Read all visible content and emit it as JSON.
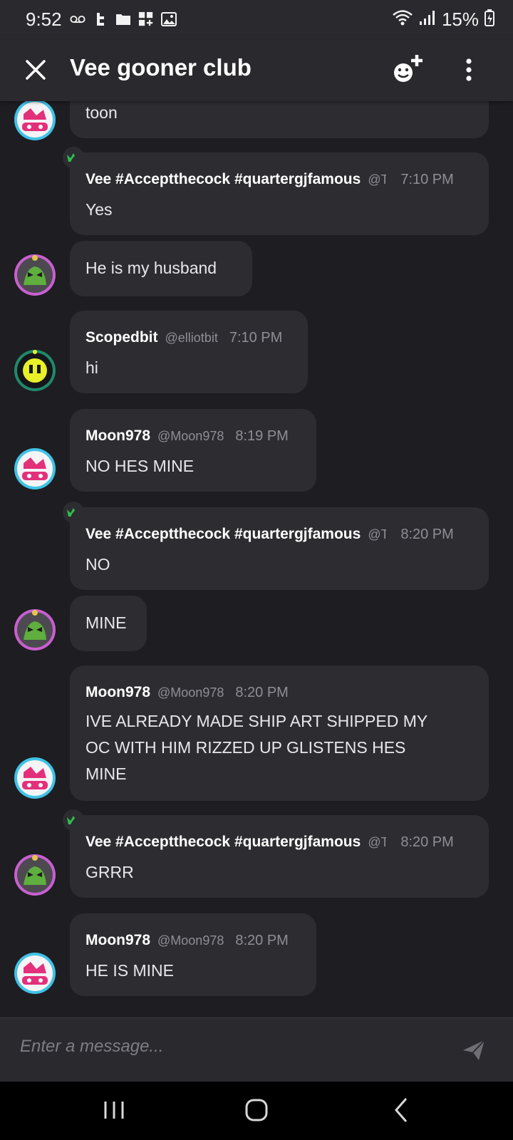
{
  "status_bar": {
    "time": "9:52",
    "battery": "15%"
  },
  "header": {
    "title": "Vee gooner club"
  },
  "messages": [
    {
      "text": "toon"
    },
    {
      "author": "Vee #Acceptthecock #quartergjfamous",
      "handle": "@Te",
      "time": "7:10 PM",
      "text": "Yes"
    },
    {
      "text": "He is my husband"
    },
    {
      "author": "Scopedbit",
      "handle": "@elliotbit",
      "time": "7:10 PM",
      "text": "hi"
    },
    {
      "author": "Moon978",
      "handle": "@Moon978",
      "time": "8:19 PM",
      "text": "NO HES MINE"
    },
    {
      "author": "Vee #Acceptthecock #quartergjfamous",
      "handle": "@Te",
      "time": "8:20 PM",
      "text": "NO"
    },
    {
      "text": "MINE"
    },
    {
      "author": "Moon978",
      "handle": "@Moon978",
      "time": "8:20 PM",
      "text_lines": [
        "IVE ALREADY MADE SHIP ART SHIPPED MY",
        "OC WITH HIM RIZZED UP GLISTENS HES",
        "MINE"
      ]
    },
    {
      "author": "Vee #Acceptthecock #quartergjfamous",
      "handle": "@Te",
      "time": "8:20 PM",
      "text": "GRRR"
    },
    {
      "author": "Moon978",
      "handle": "@Moon978",
      "time": "8:20 PM",
      "text": "HE IS MINE"
    }
  ],
  "composer": {
    "placeholder": "Enter a message..."
  },
  "colors": {
    "background": "#1e1d22",
    "bubble": "#2d2c31",
    "header": "#2a292e",
    "crown": "#2fbf4f"
  }
}
